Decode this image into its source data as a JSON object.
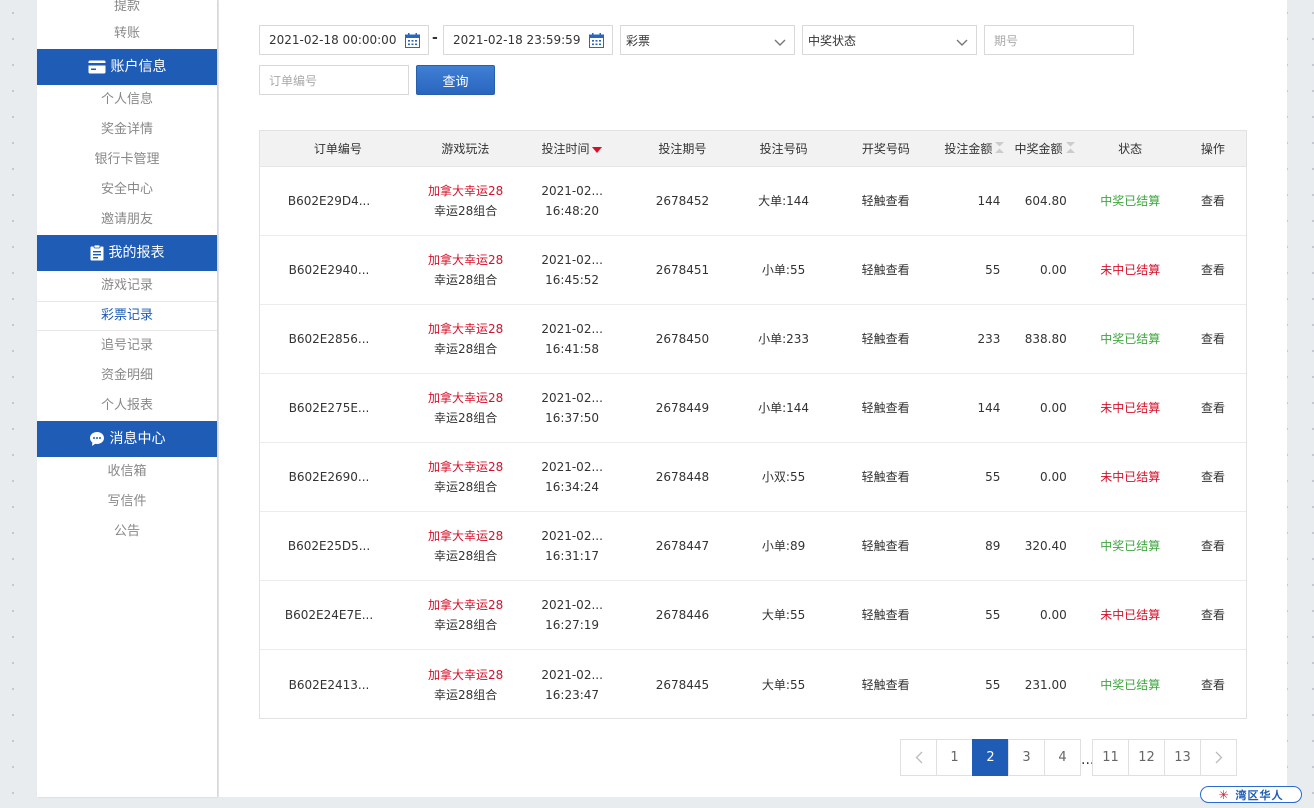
{
  "sidebar": {
    "top_items": [
      {
        "label": "提款",
        "partial": true
      },
      {
        "label": "转账"
      }
    ],
    "sections": [
      {
        "title": "账户信息",
        "icon": "card-icon",
        "items": [
          "个人信息",
          "奖金详情",
          "银行卡管理",
          "安全中心",
          "邀请朋友"
        ]
      },
      {
        "title": "我的报表",
        "icon": "report-icon",
        "items": [
          "游戏记录",
          "彩票记录",
          "追号记录",
          "资金明细",
          "个人报表"
        ],
        "active": "彩票记录"
      },
      {
        "title": "消息中心",
        "icon": "message-icon",
        "items": [
          "收信箱",
          "写信件",
          "公告"
        ]
      }
    ]
  },
  "filters": {
    "start_time": "2021-02-18 00:00:00",
    "end_time": "2021-02-18 23:59:59",
    "separator": "-",
    "lottery_select": "彩票",
    "status_select": "中奖状态",
    "period_placeholder": "期号",
    "order_placeholder": "订单编号",
    "query_label": "查询"
  },
  "table": {
    "headers": [
      "订单编号",
      "游戏玩法",
      "投注时间",
      "投注期号",
      "投注号码",
      "开奖号码",
      "投注金额",
      "中奖金额",
      "状态",
      "操作"
    ],
    "sort_active_color": "#d6102a",
    "rows": [
      {
        "order": "B602E29D4...",
        "game": "加拿大幸运28",
        "play": "幸运28组合",
        "date": "2021-02...",
        "time": "16:48:20",
        "period": "2678452",
        "bet": "大单:144",
        "draw": "轻触查看",
        "amount": "144",
        "win": "604.80",
        "status": "中奖已结算",
        "won": true,
        "action": "查看"
      },
      {
        "order": "B602E2940...",
        "game": "加拿大幸运28",
        "play": "幸运28组合",
        "date": "2021-02...",
        "time": "16:45:52",
        "period": "2678451",
        "bet": "小单:55",
        "draw": "轻触查看",
        "amount": "55",
        "win": "0.00",
        "status": "未中已结算",
        "won": false,
        "action": "查看"
      },
      {
        "order": "B602E2856...",
        "game": "加拿大幸运28",
        "play": "幸运28组合",
        "date": "2021-02...",
        "time": "16:41:58",
        "period": "2678450",
        "bet": "小单:233",
        "draw": "轻触查看",
        "amount": "233",
        "win": "838.80",
        "status": "中奖已结算",
        "won": true,
        "action": "查看"
      },
      {
        "order": "B602E275E...",
        "game": "加拿大幸运28",
        "play": "幸运28组合",
        "date": "2021-02...",
        "time": "16:37:50",
        "period": "2678449",
        "bet": "小单:144",
        "draw": "轻触查看",
        "amount": "144",
        "win": "0.00",
        "status": "未中已结算",
        "won": false,
        "action": "查看"
      },
      {
        "order": "B602E2690...",
        "game": "加拿大幸运28",
        "play": "幸运28组合",
        "date": "2021-02...",
        "time": "16:34:24",
        "period": "2678448",
        "bet": "小双:55",
        "draw": "轻触查看",
        "amount": "55",
        "win": "0.00",
        "status": "未中已结算",
        "won": false,
        "action": "查看"
      },
      {
        "order": "B602E25D5...",
        "game": "加拿大幸运28",
        "play": "幸运28组合",
        "date": "2021-02...",
        "time": "16:31:17",
        "period": "2678447",
        "bet": "小单:89",
        "draw": "轻触查看",
        "amount": "89",
        "win": "320.40",
        "status": "中奖已结算",
        "won": true,
        "action": "查看"
      },
      {
        "order": "B602E24E7E...",
        "game": "加拿大幸运28",
        "play": "幸运28组合",
        "date": "2021-02...",
        "time": "16:27:19",
        "period": "2678446",
        "bet": "大单:55",
        "draw": "轻触查看",
        "amount": "55",
        "win": "0.00",
        "status": "未中已结算",
        "won": false,
        "action": "查看"
      },
      {
        "order": "B602E2413...",
        "game": "加拿大幸运28",
        "play": "幸运28组合",
        "date": "2021-02...",
        "time": "16:23:47",
        "period": "2678445",
        "bet": "大单:55",
        "draw": "轻触查看",
        "amount": "55",
        "win": "231.00",
        "status": "中奖已结算",
        "won": true,
        "action": "查看"
      }
    ]
  },
  "pagination": {
    "pages_before": [
      "1",
      "2",
      "3",
      "4"
    ],
    "dots": "...",
    "pages_after": [
      "11",
      "12",
      "13"
    ],
    "current": "2"
  },
  "badge": {
    "text": "湾区华人",
    "star": "✳"
  },
  "colors": {
    "brand": "#1e5cb6",
    "win": "#3fa53f",
    "lose": "#d6102a"
  }
}
